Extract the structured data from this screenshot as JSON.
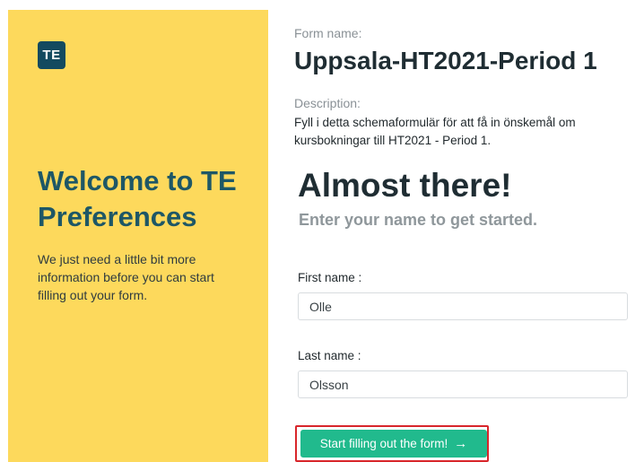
{
  "left_panel": {
    "logo_text": "TE",
    "title": "Welcome to TE Preferences",
    "text": "We just need a little bit more information before you can start filling out your form."
  },
  "form": {
    "name_label": "Form name:",
    "name": "Uppsala-HT2021-Period 1",
    "description_label": "Description:",
    "description": "Fyll i detta schemaformulär för att få in önskemål om kursbokningar till HT2021 - Period 1."
  },
  "intro": {
    "heading": "Almost there!",
    "subheading": "Enter your name to get started."
  },
  "fields": {
    "first_name_label": "First name :",
    "first_name_value": "Olle",
    "last_name_label": "Last name :",
    "last_name_value": "Olsson"
  },
  "start_button": {
    "label": "Start filling out the form!",
    "icon": "arrow-right-icon",
    "color": "#21ba8d"
  },
  "colors": {
    "panel": "#fdd95c",
    "logo": "#134a5f",
    "title": "#1e5766",
    "highlight": "#d8262b"
  }
}
